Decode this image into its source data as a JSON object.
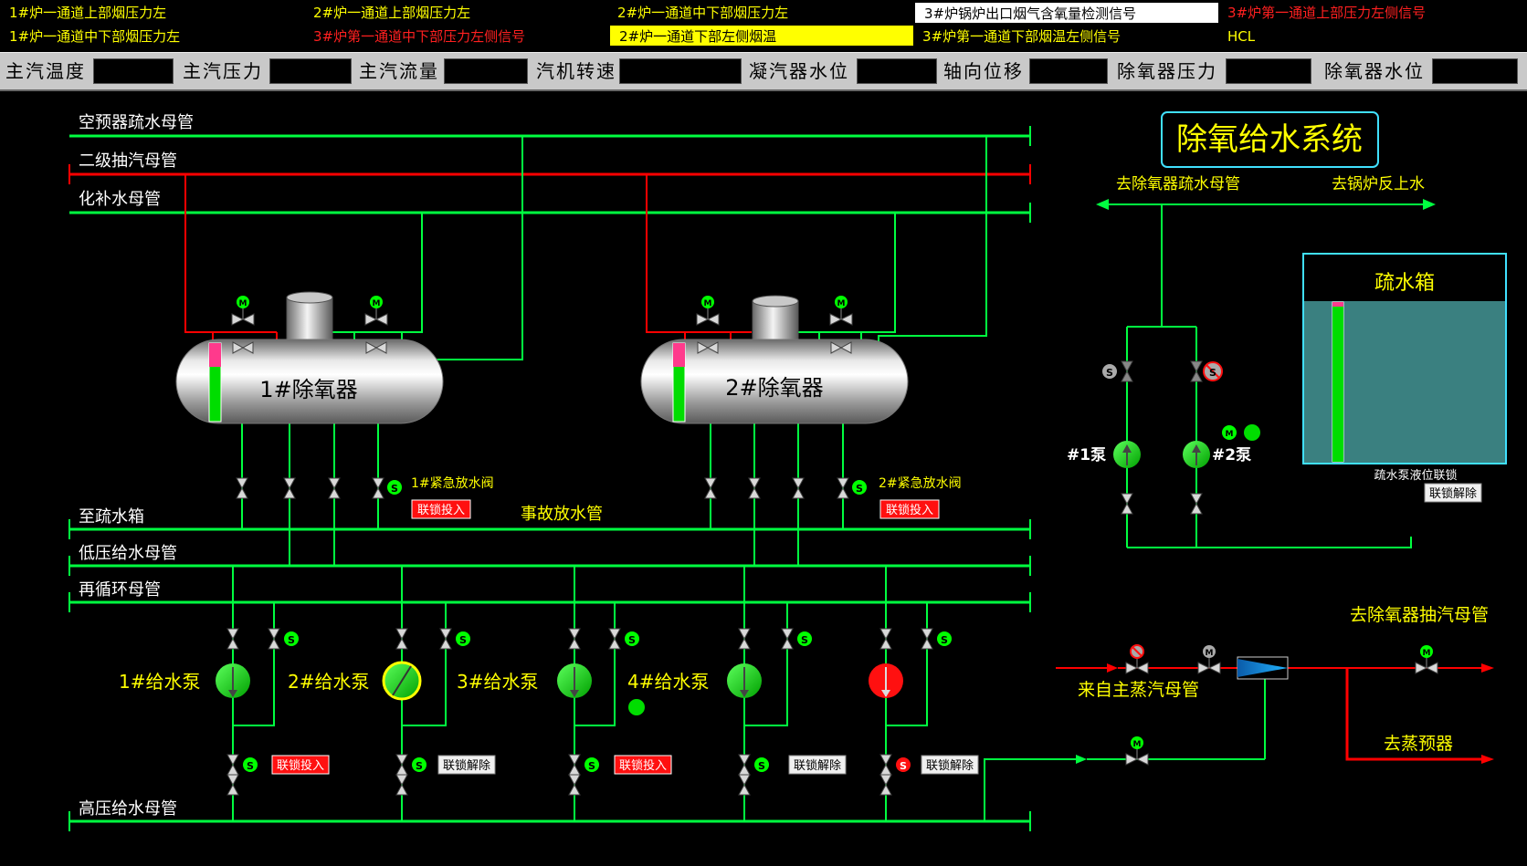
{
  "alarms": [
    {
      "text": "1#炉一通道上部烟压力左",
      "color": "#ffff00",
      "bg": "#000000"
    },
    {
      "text": "2#炉一通道上部烟压力左",
      "color": "#ffff00",
      "bg": "#000000"
    },
    {
      "text": "2#炉一通道中下部烟压力左",
      "color": "#ffff00",
      "bg": "#000000"
    },
    {
      "text": "3#炉锅炉出口烟气含氧量检测信号",
      "color": "#000000",
      "bg": "#ffffff"
    },
    {
      "text": "3#炉第一通道上部压力左侧信号",
      "color": "#ff2020",
      "bg": "#000000"
    },
    {
      "text": "1#炉一通道中下部烟压力左",
      "color": "#ffff00",
      "bg": "#000000"
    },
    {
      "text": "3#炉第一通道中下部压力左侧信号",
      "color": "#ff2020",
      "bg": "#000000"
    },
    {
      "text": "2#炉一通道下部左侧烟温",
      "color": "#000000",
      "bg": "#ffff00"
    },
    {
      "text": "3#炉第一通道下部烟温左侧信号",
      "color": "#ffff00",
      "bg": "#000000"
    },
    {
      "text": "HCL",
      "color": "#ffff00",
      "bg": "#000000"
    }
  ],
  "params": [
    {
      "label": "主汽温度",
      "value": ""
    },
    {
      "label": "主汽压力",
      "value": ""
    },
    {
      "label": "主汽流量",
      "value": ""
    },
    {
      "label": "汽机转速",
      "value": ""
    },
    {
      "label": "凝汽器水位",
      "value": ""
    },
    {
      "label": "轴向位移",
      "value": ""
    },
    {
      "label": "除氧器压力",
      "value": ""
    },
    {
      "label": "除氧器水位",
      "value": ""
    }
  ],
  "diagram": {
    "title": "除氧给水系统",
    "headers": {
      "air_preheater_drain": "空预器疏水母管",
      "second_extraction": "二级抽汽母管",
      "makeup_water": "化补水母管",
      "to_drain_tank": "至疏水箱",
      "emergency_drain": "事故放水管",
      "low_pressure_feed": "低压给水母管",
      "recirculation": "再循环母管",
      "high_pressure_feed": "高压给水母管"
    },
    "deaerators": [
      {
        "name": "1#除氧器",
        "emergency_valve": "1#紧急放水阀",
        "interlock": "联锁投入"
      },
      {
        "name": "2#除氧器",
        "emergency_valve": "2#紧急放水阀",
        "interlock": "联锁投入"
      }
    ],
    "feed_pumps": [
      {
        "name": "1#给水泵",
        "interlock": "联锁投入",
        "state": "running"
      },
      {
        "name": "2#给水泵",
        "interlock": "联锁解除",
        "state": "running"
      },
      {
        "name": "3#给水泵",
        "interlock": "联锁投入",
        "state": "running"
      },
      {
        "name": "4#给水泵",
        "interlock": "联锁解除",
        "state": "running"
      },
      {
        "name": "",
        "interlock": "联锁解除",
        "state": "stopped"
      }
    ],
    "drain_system": {
      "to_deaerator_drain": "去除氧器疏水母管",
      "to_boiler": "去锅炉反上水",
      "tank_label": "疏水箱",
      "pump1": "#1泵",
      "pump2": "#2泵",
      "interlock_caption": "疏水泵液位联锁",
      "interlock_button": "联锁解除",
      "tank_level": 0.98
    },
    "steam": {
      "to_extraction": "去除氧器抽汽母管",
      "from_main_steam": "来自主蒸汽母管",
      "to_preheater": "去蒸预器"
    },
    "icons": {
      "motor": "M",
      "solenoid": "S"
    },
    "colors": {
      "pipe_water": "#00ff40",
      "pipe_steam": "#ff0000",
      "text_label": "#ffffff",
      "text_yellow": "#ffff00",
      "running": "#00ff00",
      "stopped": "#ff0000",
      "interlock_on": "#ff0000",
      "interlock_off": "#ffffff"
    }
  }
}
